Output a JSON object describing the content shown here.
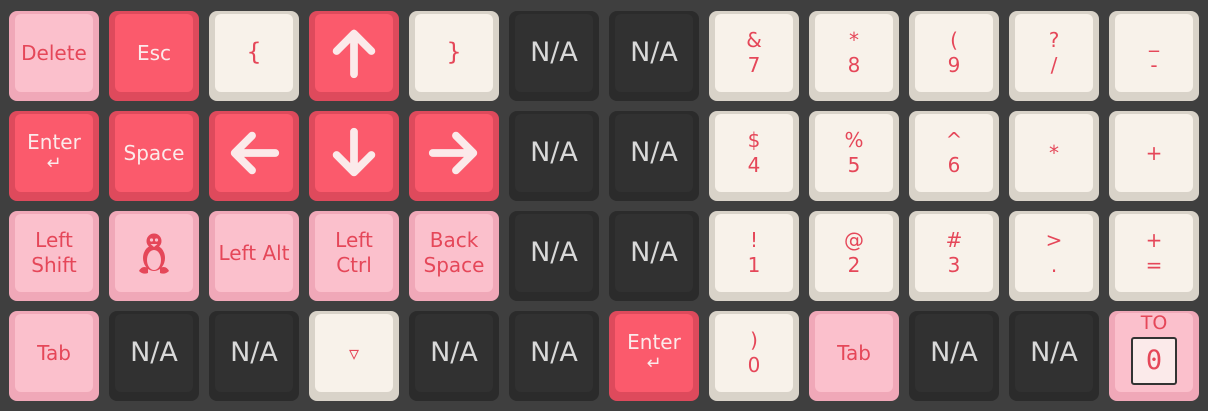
{
  "keyboard": {
    "colors": {
      "background": "#3f3f3f",
      "pink_key": "#fbc0cc",
      "red_key": "#fb5a6c",
      "cream_key": "#f8f2ea",
      "dark_key": "#313131",
      "legend_red": "#e54759"
    },
    "rows": [
      {
        "keys": [
          {
            "label": "Delete"
          },
          {
            "label": "Esc"
          },
          {
            "label": "{"
          },
          {
            "icon": "arrow-up-icon"
          },
          {
            "label": "}"
          },
          {
            "label": "N/A"
          },
          {
            "label": "N/A"
          },
          {
            "top": "&",
            "bottom": "7"
          },
          {
            "top": "*",
            "bottom": "8"
          },
          {
            "top": "(",
            "bottom": "9"
          },
          {
            "top": "?",
            "bottom": "/"
          },
          {
            "top": "_",
            "bottom": "-"
          }
        ]
      },
      {
        "keys": [
          {
            "label": "Enter",
            "glyph": "↵"
          },
          {
            "label": "Space"
          },
          {
            "icon": "arrow-left-icon"
          },
          {
            "icon": "arrow-down-icon"
          },
          {
            "icon": "arrow-right-icon"
          },
          {
            "label": "N/A"
          },
          {
            "label": "N/A"
          },
          {
            "top": "$",
            "bottom": "4"
          },
          {
            "top": "%",
            "bottom": "5"
          },
          {
            "top": "^",
            "bottom": "6"
          },
          {
            "label": "*"
          },
          {
            "label": "+"
          }
        ]
      },
      {
        "keys": [
          {
            "top": "Left",
            "bottom": "Shift"
          },
          {
            "icon": "linux-tux-icon"
          },
          {
            "label": "Left Alt"
          },
          {
            "top": "Left",
            "bottom": "Ctrl"
          },
          {
            "top": "Back",
            "bottom": "Space"
          },
          {
            "label": "N/A"
          },
          {
            "label": "N/A"
          },
          {
            "top": "!",
            "bottom": "1"
          },
          {
            "top": "@",
            "bottom": "2"
          },
          {
            "top": "#",
            "bottom": "3"
          },
          {
            "top": ">",
            "bottom": "."
          },
          {
            "top": "+",
            "bottom": "="
          }
        ]
      },
      {
        "keys": [
          {
            "label": "Tab"
          },
          {
            "label": "N/A"
          },
          {
            "label": "N/A"
          },
          {
            "label": "▿"
          },
          {
            "label": "N/A"
          },
          {
            "label": "N/A"
          },
          {
            "label": "Enter",
            "glyph": "↵"
          },
          {
            "top": ")",
            "bottom": "0"
          },
          {
            "label": "Tab"
          },
          {
            "label": "N/A"
          },
          {
            "label": "N/A"
          },
          {
            "label": "TO",
            "box": "0"
          }
        ]
      }
    ]
  }
}
